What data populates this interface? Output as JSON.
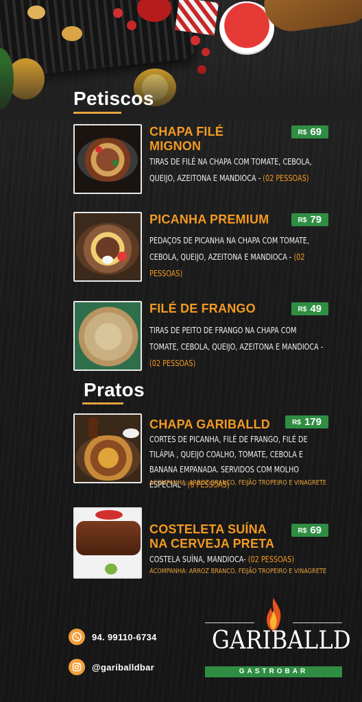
{
  "sections": {
    "petiscos": "Petiscos",
    "pratos": "Pratos"
  },
  "items": [
    {
      "name_line1": "CHAPA FILÉ",
      "name_line2": "MIGNON",
      "currency": "R$",
      "price": "69",
      "desc": "TIRAS DE FILÉ NA CHAPA COM TOMATE, CEBOLA, QUEIJO, AZEITONA E MANDIOCA - ",
      "people": "(02 PESSOAS)"
    },
    {
      "name_line1": "PICANHA PREMIUM",
      "currency": "R$",
      "price": "79",
      "desc": "PEDAÇOS DE PICANHA NA CHAPA COM TOMATE, CEBOLA, QUEIJO, AZEITONA E MANDIOCA - ",
      "people": "(02 PESSOAS)"
    },
    {
      "name_line1": "FILÉ DE FRANGO",
      "currency": "R$",
      "price": "49",
      "desc": "TIRAS DE PEITO DE FRANGO NA CHAPA COM TOMATE, CEBOLA, QUEIJO, AZEITONA E MANDIOCA - ",
      "people": "(02 PESSOAS)"
    },
    {
      "name_line1": "CHAPA GARIBALLD",
      "currency": "R$",
      "price": "179",
      "desc": "CORTES DE PICANHA, FILÉ DE FRANGO, FILÉ DE TILÁPIA , QUEIJO COALHO, TOMATE, CEBOLA E BANANA EMPANADA. SERVIDOS COM MOLHO ESPECIAL - ",
      "people": "(6 PESSOAS)",
      "accomp": "ACOMPANHA: ARROZ BRANCO, FEIJÃO TROPEIRO E VINAGRETE"
    },
    {
      "name_line1": "COSTELETA SUÍNA",
      "name_line2": "NA CERVEJA PRETA",
      "currency": "R$",
      "price": "69",
      "desc": "COSTELA SUÍNA, MANDIOCA- ",
      "people": "(02 PESSOAS)",
      "accomp": "ACOMPANHA: ARROZ BRANCO, FEIJÃO TROPEIRO E VINAGRETE"
    }
  ],
  "contact": {
    "phone": "94. 99110-6734",
    "instagram": "@gariballdbar"
  },
  "logo": {
    "brand": "GARIBALLD",
    "tagline": "GASTROBAR"
  },
  "colors": {
    "accent": "#f39a22",
    "price_badge": "#2f8e43",
    "background": "#1d1d1d"
  },
  "icons": [
    "whatsapp-icon",
    "instagram-icon",
    "flame-icon"
  ]
}
